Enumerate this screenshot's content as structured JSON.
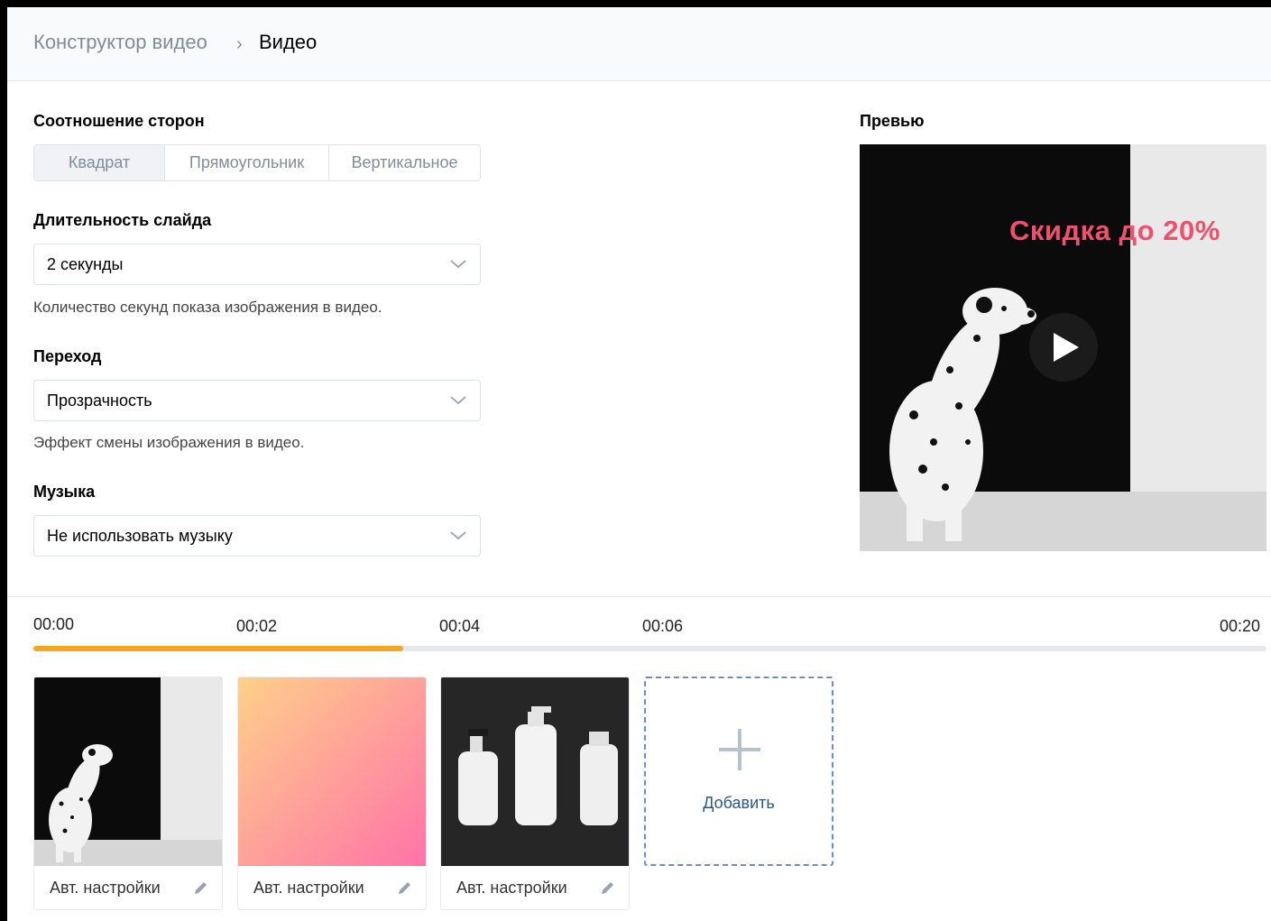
{
  "breadcrumb": {
    "root": "Конструктор видео",
    "separator": "›",
    "current": "Видео"
  },
  "aspect_ratio": {
    "label": "Соотношение сторон",
    "options": [
      "Квадрат",
      "Прямоугольник",
      "Вертикальное"
    ],
    "selected": "Квадрат"
  },
  "slide_duration": {
    "label": "Длительность слайда",
    "value": "2 секунды",
    "hint": "Количество секунд показа изображения в видео."
  },
  "transition": {
    "label": "Переход",
    "value": "Прозрачность",
    "hint": "Эффект смены изображения в видео."
  },
  "music": {
    "label": "Музыка",
    "value": "Не использовать музыку"
  },
  "preview": {
    "label": "Превью",
    "promo_text": "Скидка до 20%"
  },
  "timeline": {
    "ticks": [
      "00:00",
      "00:02",
      "00:04",
      "00:06",
      "00:20"
    ],
    "progress": 0.3
  },
  "slides": [
    {
      "label": "Авт. настройки",
      "icon": "pencil-icon"
    },
    {
      "label": "Авт. настройки",
      "icon": "pencil-icon"
    },
    {
      "label": "Авт. настройки",
      "icon": "pencil-icon"
    }
  ],
  "add_slide": {
    "label": "Добавить",
    "icon": "plus-icon"
  },
  "colors": {
    "accent_progress": "#f5a623",
    "promo_text": "#f0506e",
    "add_border": "#6b8fc2",
    "link": "#2a5885"
  }
}
